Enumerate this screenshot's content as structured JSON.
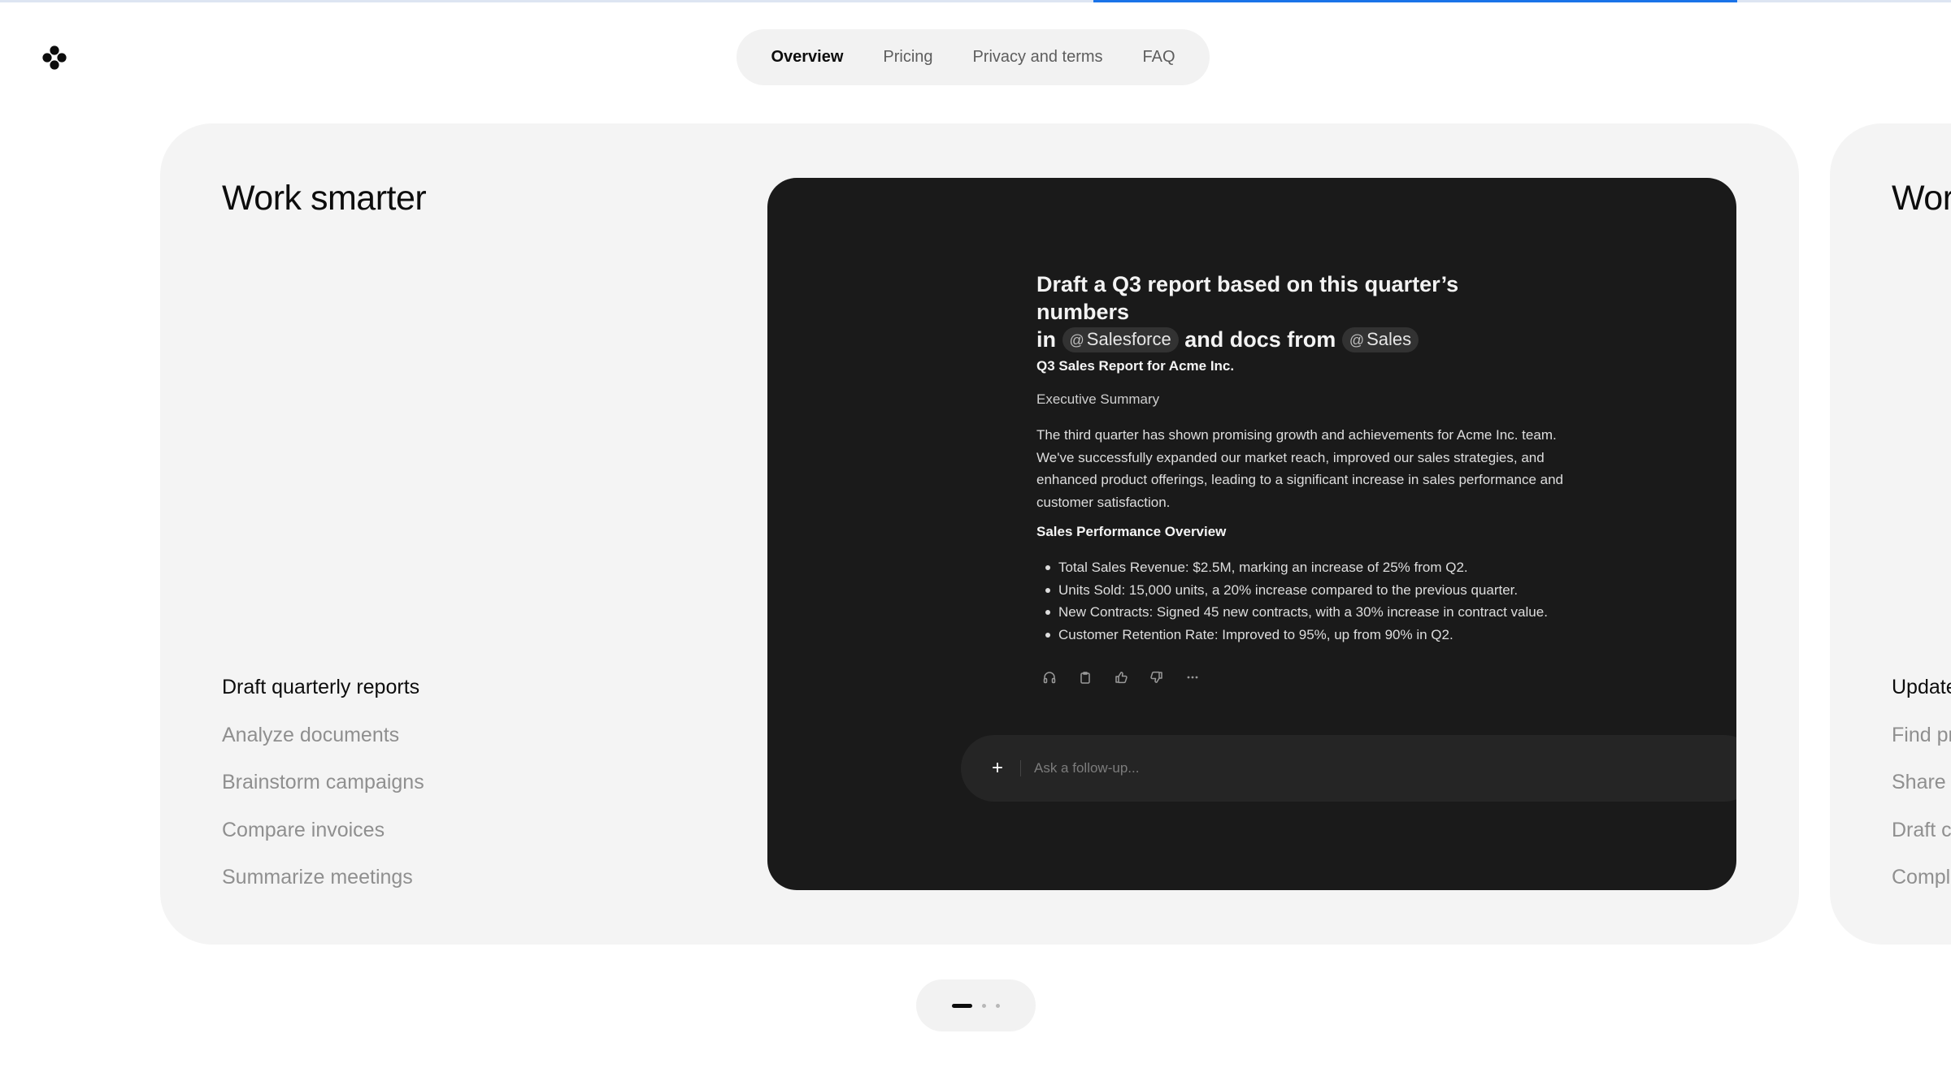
{
  "brand": {
    "logo_icon": "four-dot-logo-icon"
  },
  "progress": {
    "fraction": 0.33,
    "track_color": "#dde5f2",
    "fill_color": "#1a73e8"
  },
  "nav": {
    "items": [
      {
        "label": "Overview",
        "active": true
      },
      {
        "label": "Pricing",
        "active": false
      },
      {
        "label": "Privacy and terms",
        "active": false
      },
      {
        "label": "FAQ",
        "active": false
      }
    ]
  },
  "card": {
    "title": "Work smarter",
    "use_cases": [
      {
        "label": "Draft quarterly reports",
        "active": true
      },
      {
        "label": "Analyze documents",
        "active": false
      },
      {
        "label": "Brainstorm campaigns",
        "active": false
      },
      {
        "label": "Compare invoices",
        "active": false
      },
      {
        "label": "Summarize meetings",
        "active": false
      }
    ],
    "demo": {
      "prompt_part1": "Draft a Q3 report based on this quarter’s numbers",
      "prompt_in": "in",
      "mention1": "Salesforce",
      "prompt_mid": "and docs from",
      "mention2": "Sales",
      "mention_prefix": "@",
      "response": {
        "title": "Q3 Sales Report for Acme Inc.",
        "subtitle": "Executive Summary",
        "body": "The third quarter has shown promising growth and achievements for Acme Inc. team. We've successfully expanded our market reach, improved our sales strategies, and enhanced product offerings, leading to a significant increase in sales performance and customer satisfaction.",
        "section_heading": "Sales Performance Overview",
        "bullets": [
          "Total Sales Revenue: $2.5M, marking an increase of 25% from Q2.",
          "Units Sold: 15,000 units, a 20% increase compared to the previous quarter.",
          "New Contracts: Signed 45 new contracts, with a 30% increase in contract value.",
          "Customer Retention Rate: Improved to 95%, up from 90% in Q2."
        ]
      },
      "actions": [
        "headphones-icon",
        "copy-icon",
        "thumbs-up-icon",
        "thumbs-down-icon",
        "more-icon"
      ],
      "followup": {
        "placeholder": "Ask a follow-up...",
        "plus_label": "+"
      }
    }
  },
  "next_card": {
    "title": "Work smarter",
    "use_cases": [
      {
        "label": "Update",
        "active": true
      },
      {
        "label": "Find pr",
        "active": false
      },
      {
        "label": "Share",
        "active": false
      },
      {
        "label": "Draft c",
        "active": false
      },
      {
        "label": "Compl",
        "active": false
      }
    ]
  },
  "pager": {
    "count": 3,
    "active_index": 0
  }
}
